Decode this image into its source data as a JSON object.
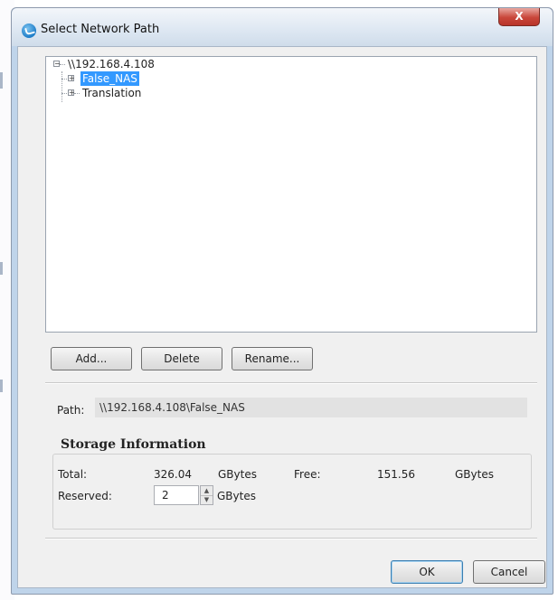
{
  "window": {
    "title": "Select Network Path",
    "close_glyph": "X"
  },
  "tree": {
    "root": {
      "label": "\\\\192.168.4.108",
      "expanded": true
    },
    "children": [
      {
        "label": "False_NAS",
        "selected": true
      },
      {
        "label": "Translation",
        "selected": false
      }
    ]
  },
  "buttons": {
    "add": "Add...",
    "delete": "Delete",
    "rename": "Rename...",
    "ok": "OK",
    "cancel": "Cancel"
  },
  "path": {
    "label": "Path:",
    "value": "\\\\192.168.4.108\\False_NAS"
  },
  "storage": {
    "title": "Storage Information",
    "total_label": "Total:",
    "total_value": "326.04",
    "total_unit": "GBytes",
    "free_label": "Free:",
    "free_value": "151.56",
    "free_unit": "GBytes",
    "reserved_label": "Reserved:",
    "reserved_value": "2",
    "reserved_unit": "GBytes"
  },
  "colors": {
    "selection": "#3399ff",
    "close_button": "#c9463a",
    "window_frame": "#bfd4ea"
  }
}
